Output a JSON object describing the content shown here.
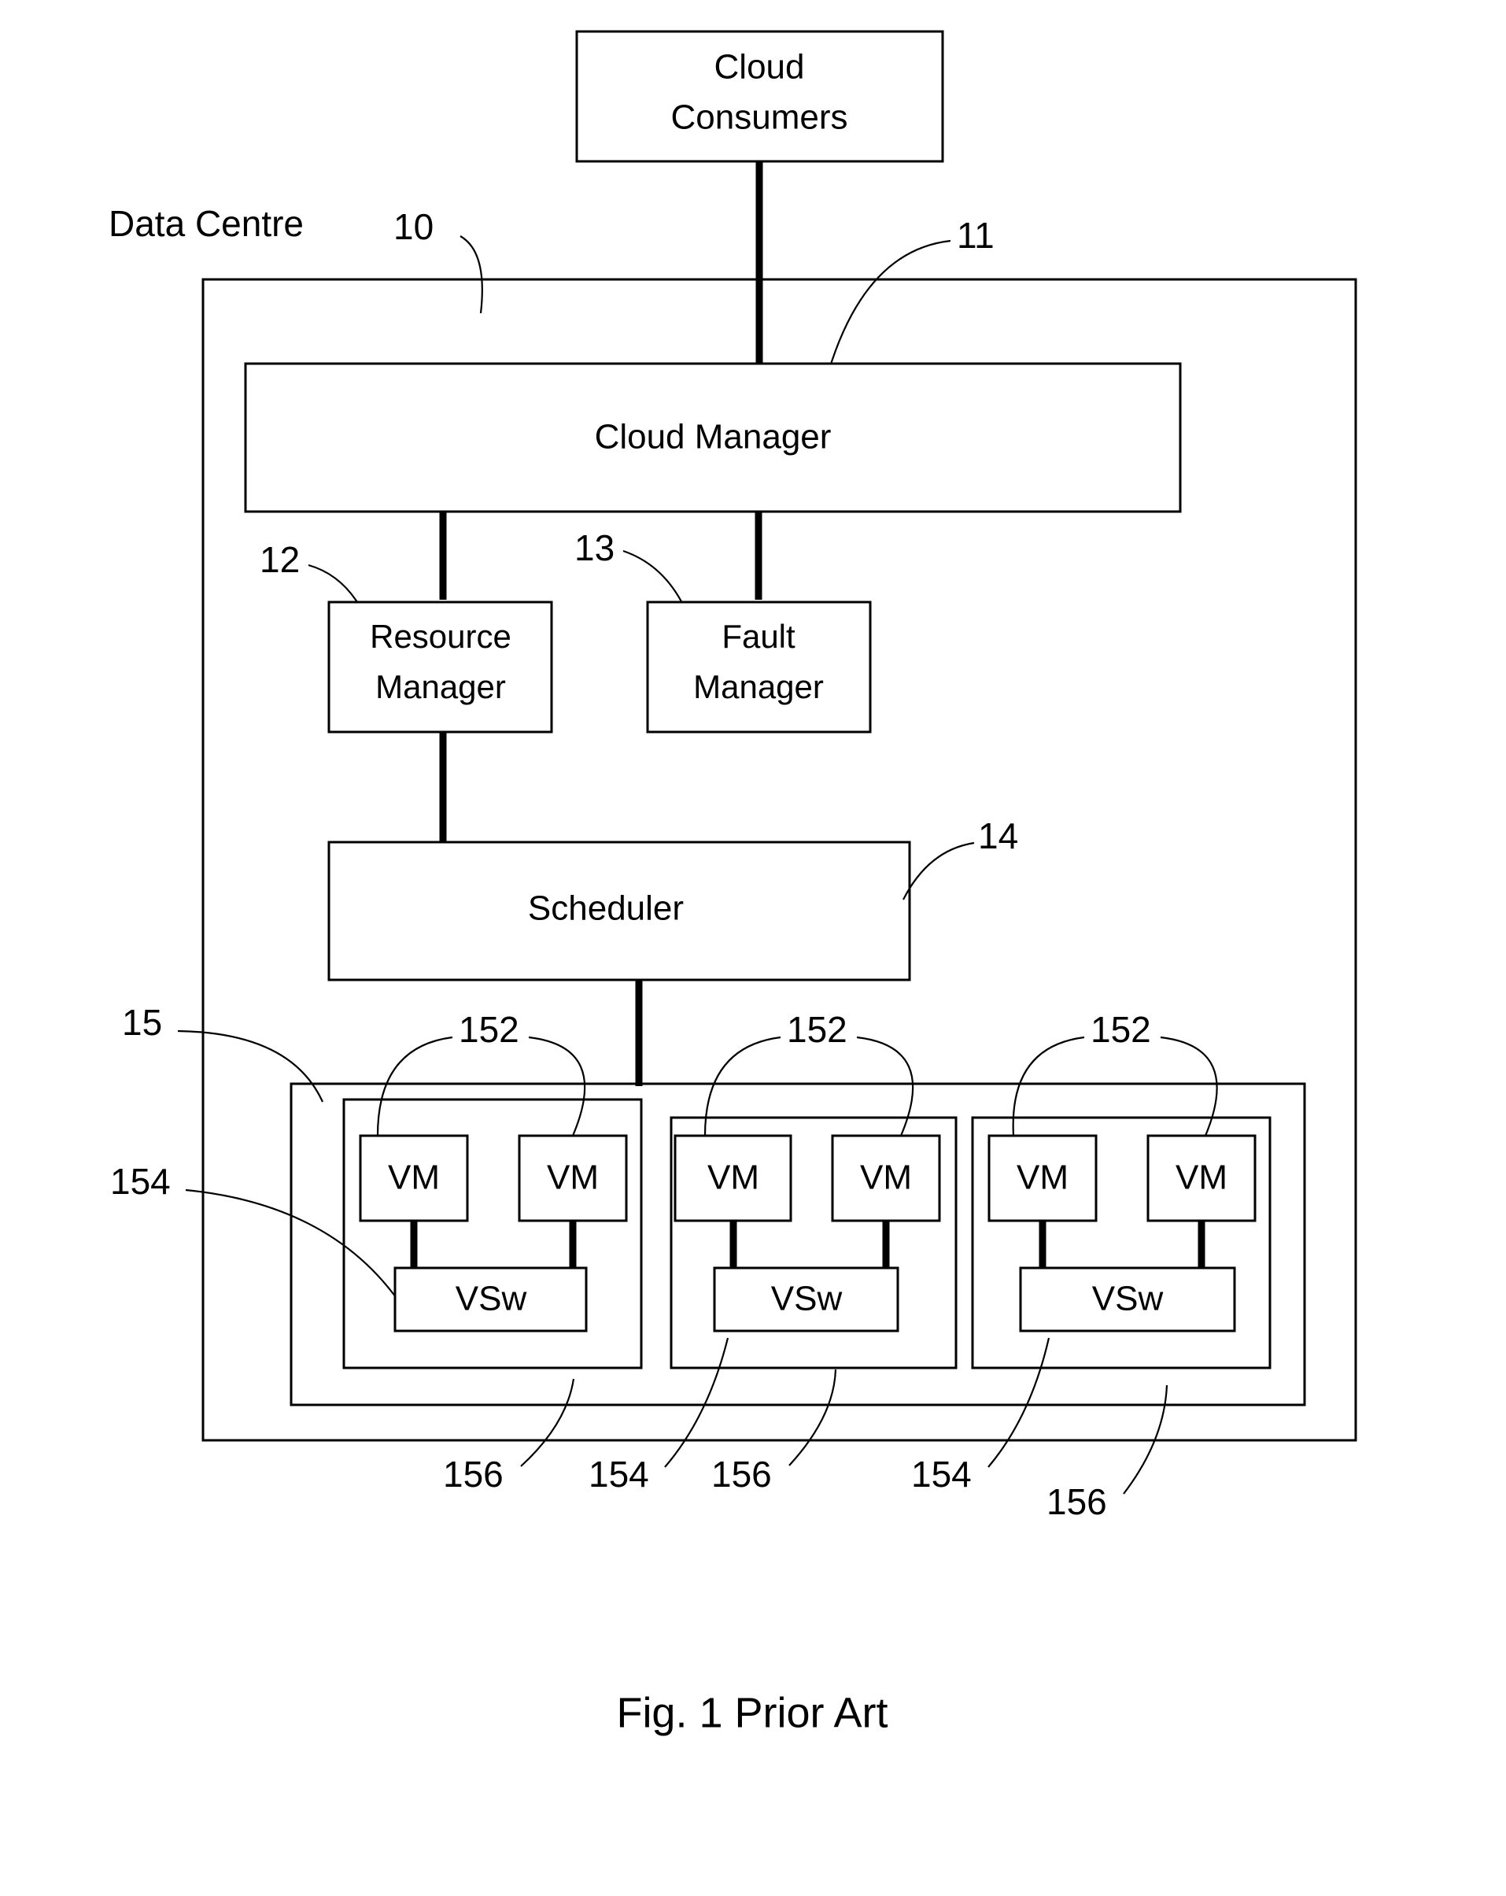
{
  "figure": {
    "caption": "Fig. 1 Prior Art",
    "data_centre_label": "Data Centre"
  },
  "nodes": {
    "cloud_consumers": {
      "line1": "Cloud",
      "line2": "Consumers"
    },
    "cloud_manager": {
      "label": "Cloud Manager"
    },
    "resource_manager": {
      "line1": "Resource",
      "line2": "Manager"
    },
    "fault_manager": {
      "line1": "Fault",
      "line2": "Manager"
    },
    "scheduler": {
      "label": "Scheduler"
    }
  },
  "hosts": [
    {
      "vm_left": "VM",
      "vm_right": "VM",
      "vswitch": "VSw",
      "ref_vm": "152",
      "ref_vswitch": "154",
      "ref_host": "156"
    },
    {
      "vm_left": "VM",
      "vm_right": "VM",
      "vswitch": "VSw",
      "ref_vm": "152",
      "ref_vswitch": "154",
      "ref_host": "156"
    },
    {
      "vm_left": "VM",
      "vm_right": "VM",
      "vswitch": "VSw",
      "ref_vm": "152",
      "ref_vswitch": "154",
      "ref_host": "156"
    }
  ],
  "reference_numerals": {
    "data_centre": "10",
    "cloud_manager": "11",
    "resource_manager": "12",
    "fault_manager": "13",
    "scheduler": "14",
    "rack": "15",
    "vm": "152",
    "vswitch": "154",
    "host": "156"
  },
  "colors": {
    "stroke": "#000000",
    "background": "#ffffff"
  }
}
